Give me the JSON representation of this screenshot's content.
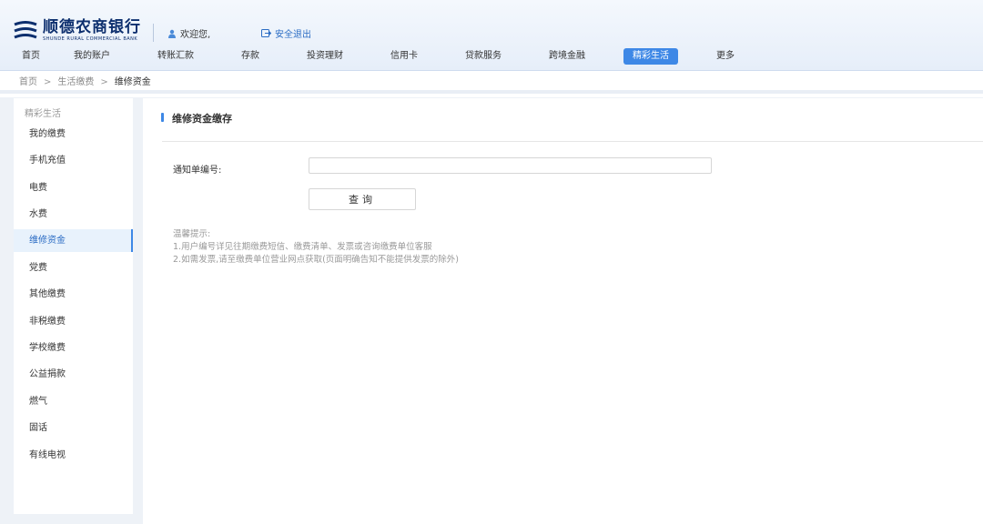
{
  "header": {
    "brand_cn": "顺德农商银行",
    "brand_en": "SHUNDE RURAL COMMERCIAL BANK",
    "welcome_text": "欢迎您,",
    "logout_text": "安全退出"
  },
  "nav": {
    "items": [
      {
        "label": "首页"
      },
      {
        "label": "我的账户"
      },
      {
        "label": "转账汇款"
      },
      {
        "label": "存款"
      },
      {
        "label": "投资理财"
      },
      {
        "label": "信用卡"
      },
      {
        "label": "贷款服务"
      },
      {
        "label": "跨境金融"
      },
      {
        "label": "精彩生活"
      },
      {
        "label": "更多"
      }
    ],
    "active_label": "精彩生活"
  },
  "breadcrumb": {
    "items": [
      "首页",
      "生活缴费",
      "维修资金"
    ],
    "separator": ">"
  },
  "sidebar": {
    "title": "精彩生活",
    "items": [
      {
        "label": "我的缴费"
      },
      {
        "label": "手机充值"
      },
      {
        "label": "电费"
      },
      {
        "label": "水费"
      },
      {
        "label": "维修资金"
      },
      {
        "label": "党费"
      },
      {
        "label": "其他缴费"
      },
      {
        "label": "非税缴费"
      },
      {
        "label": "学校缴费"
      },
      {
        "label": "公益捐款"
      },
      {
        "label": "燃气"
      },
      {
        "label": "固话"
      },
      {
        "label": "有线电视"
      }
    ],
    "active_label": "维修资金"
  },
  "main": {
    "section_title": "维修资金缴存",
    "form": {
      "notice_label": "通知单编号:",
      "notice_value": "",
      "notice_placeholder": "",
      "query_button": "查询"
    },
    "tips": {
      "title": "温馨提示:",
      "line1": "1.用户编号详见往期缴费短信、缴费清单、发票或咨询缴费单位客服",
      "line2": "2.如需发票,请至缴费单位营业网点获取(页面明确告知不能提供发票的除外)"
    }
  },
  "colors": {
    "accent": "#3e88e6",
    "link": "#2b6cc4",
    "brand_navy": "#0d2f6e"
  }
}
